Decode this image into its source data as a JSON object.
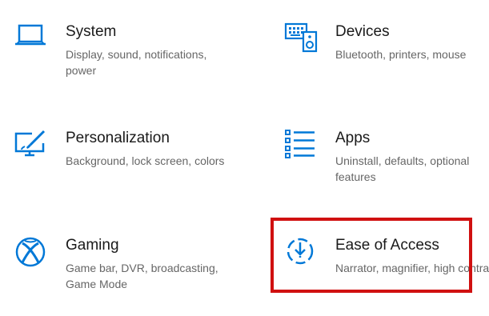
{
  "accent_color": "#0078d7",
  "highlight_color": "#d01010",
  "tiles": [
    {
      "title": "System",
      "description": "Display, sound, notifications, power",
      "icon": "laptop-icon"
    },
    {
      "title": "Devices",
      "description": "Bluetooth, printers, mouse",
      "icon": "keyboard-speaker-icon"
    },
    {
      "title": "Personalization",
      "description": "Background, lock screen, colors",
      "icon": "paintbrush-screen-icon"
    },
    {
      "title": "Apps",
      "description": "Uninstall, defaults, optional features",
      "icon": "list-icon"
    },
    {
      "title": "Gaming",
      "description": "Game bar, DVR, broadcasting, Game Mode",
      "icon": "xbox-icon"
    },
    {
      "title": "Ease of Access",
      "description": "Narrator, magnifier, high contrast",
      "icon": "ease-of-access-icon"
    }
  ]
}
